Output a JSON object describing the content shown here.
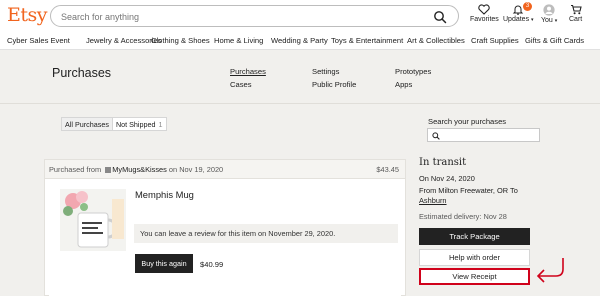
{
  "header": {
    "logo": "Etsy",
    "search_placeholder": "Search for anything",
    "icons": [
      {
        "name": "favorites",
        "label": "Favorites"
      },
      {
        "name": "updates",
        "label": "Updates",
        "badge": "3"
      },
      {
        "name": "you",
        "label": "You"
      },
      {
        "name": "cart",
        "label": "Cart"
      }
    ]
  },
  "category_nav": [
    "Cyber Sales Event",
    "Jewelry & Accessories",
    "Clothing & Shoes",
    "Home & Living",
    "Wedding & Party",
    "Toys & Entertainment",
    "Art & Collectibles",
    "Craft Supplies",
    "Gifts & Gift Cards"
  ],
  "page": {
    "title": "Purchases",
    "tabs": [
      "Purchases",
      "Cases",
      "Settings",
      "Public Profile",
      "Prototypes",
      "Apps"
    ]
  },
  "filters": {
    "all": "All Purchases",
    "not_shipped": "Not Shipped",
    "not_shipped_count": "1"
  },
  "search_purchases": {
    "label": "Search your purchases",
    "value": ""
  },
  "order": {
    "from_prefix": "Purchased from",
    "shop": "MyMugs&Kisses",
    "date_text": "on Nov 19, 2020",
    "total": "$43.45",
    "item_title": "Memphis Mug",
    "review_text": "You can leave a review for this item on November 29, 2020.",
    "buy_again": "Buy this again",
    "item_price": "$40.99"
  },
  "shipping": {
    "status": "In transit",
    "date": "On Nov 24, 2020",
    "route": "From Milton Freewater, OR To",
    "destination": "Ashburn",
    "estimate": "Estimated delivery: Nov 28",
    "track_button": "Track Package",
    "help_button": "Help with order",
    "receipt_button": "View Receipt"
  },
  "colors": {
    "brand": "#f1641e",
    "highlight": "#d0021b",
    "panel_bg": "#f1f0ed"
  }
}
